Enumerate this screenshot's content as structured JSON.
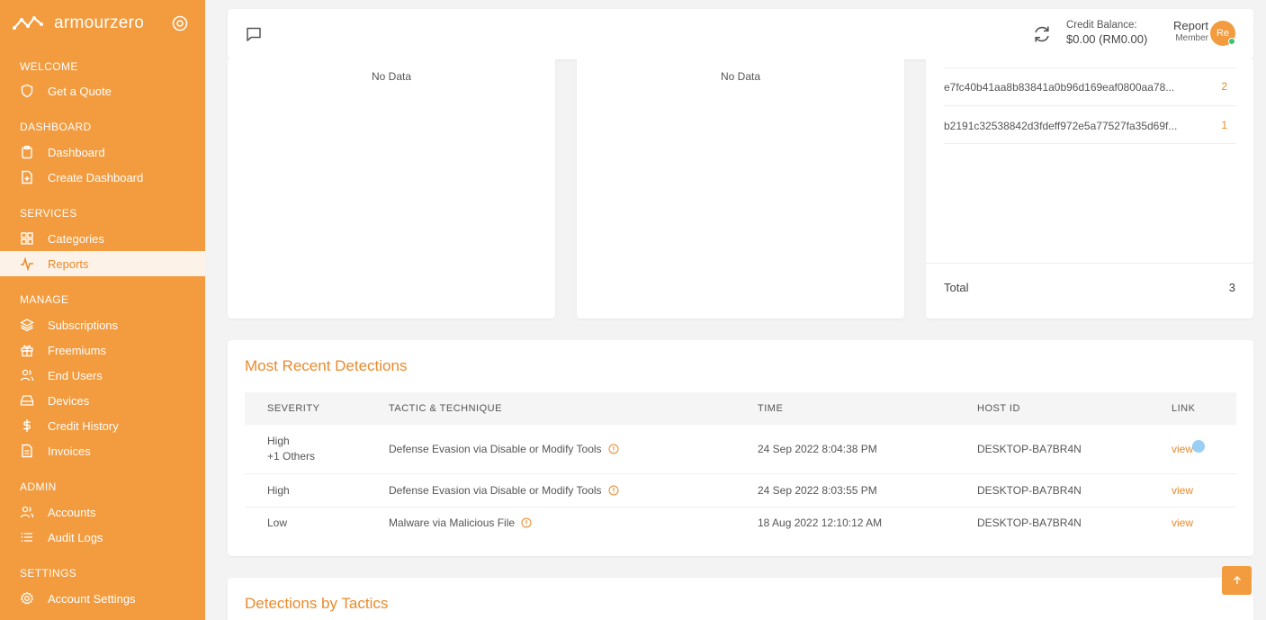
{
  "brand": {
    "name": "armourzero"
  },
  "sidebar": {
    "sections": [
      {
        "title": "WELCOME",
        "items": [
          {
            "label": "Get a Quote",
            "icon": "shield-icon"
          }
        ]
      },
      {
        "title": "DASHBOARD",
        "items": [
          {
            "label": "Dashboard",
            "icon": "clipboard-icon"
          },
          {
            "label": "Create Dashboard",
            "icon": "file-plus-icon"
          }
        ]
      },
      {
        "title": "SERVICES",
        "items": [
          {
            "label": "Categories",
            "icon": "grid-icon"
          },
          {
            "label": "Reports",
            "icon": "activity-icon",
            "active": true
          }
        ]
      },
      {
        "title": "MANAGE",
        "items": [
          {
            "label": "Subscriptions",
            "icon": "layers-icon"
          },
          {
            "label": "Freemiums",
            "icon": "gift-icon"
          },
          {
            "label": "End Users",
            "icon": "users-icon"
          },
          {
            "label": "Devices",
            "icon": "hard-drive-icon"
          },
          {
            "label": "Credit History",
            "icon": "dollar-icon"
          },
          {
            "label": "Invoices",
            "icon": "file-text-icon"
          }
        ]
      },
      {
        "title": "ADMIN",
        "items": [
          {
            "label": "Accounts",
            "icon": "users-icon"
          },
          {
            "label": "Audit Logs",
            "icon": "list-icon"
          }
        ]
      },
      {
        "title": "SETTINGS",
        "items": [
          {
            "label": "Account Settings",
            "icon": "settings-icon"
          }
        ]
      }
    ]
  },
  "topbar": {
    "credit_label": "Credit Balance:",
    "credit_amount": "$0.00 (RM0.00)",
    "user_name": "Report",
    "user_role": "Member",
    "avatar_initials": "Re"
  },
  "cards": {
    "card1_empty": "No Data",
    "card2_empty": "No Data",
    "hashes": [
      {
        "hash": "e7fc40b41aa8b83841a0b96d169eaf0800aa78...",
        "count": "2"
      },
      {
        "hash": "b2191c32538842d3fdeff972e5a77527fa35d69f...",
        "count": "1"
      }
    ],
    "total_label": "Total",
    "total_value": "3"
  },
  "detections": {
    "title": "Most Recent Detections",
    "columns": [
      "SEVERITY",
      "TACTIC & TECHNIQUE",
      "TIME",
      "HOST ID",
      "LINK"
    ],
    "rows": [
      {
        "severity": "High",
        "severity_extra": "+1 Others",
        "tactic": "Defense Evasion via Disable or Modify Tools",
        "time": "24 Sep 2022 8:04:38 PM",
        "host": "DESKTOP-BA7BR4N",
        "link": "view"
      },
      {
        "severity": "High",
        "severity_extra": "",
        "tactic": "Defense Evasion via Disable or Modify Tools",
        "time": "24 Sep 2022 8:03:55 PM",
        "host": "DESKTOP-BA7BR4N",
        "link": "view"
      },
      {
        "severity": "Low",
        "severity_extra": "",
        "tactic": "Malware via Malicious File",
        "time": "18 Aug 2022 12:10:12 AM",
        "host": "DESKTOP-BA7BR4N",
        "link": "view"
      }
    ]
  },
  "tactics": {
    "title": "Detections by Tactics"
  },
  "colors": {
    "accent": "#f29b3f",
    "accent_text": "#e98a2c",
    "active_bg": "#fdf2e7"
  }
}
